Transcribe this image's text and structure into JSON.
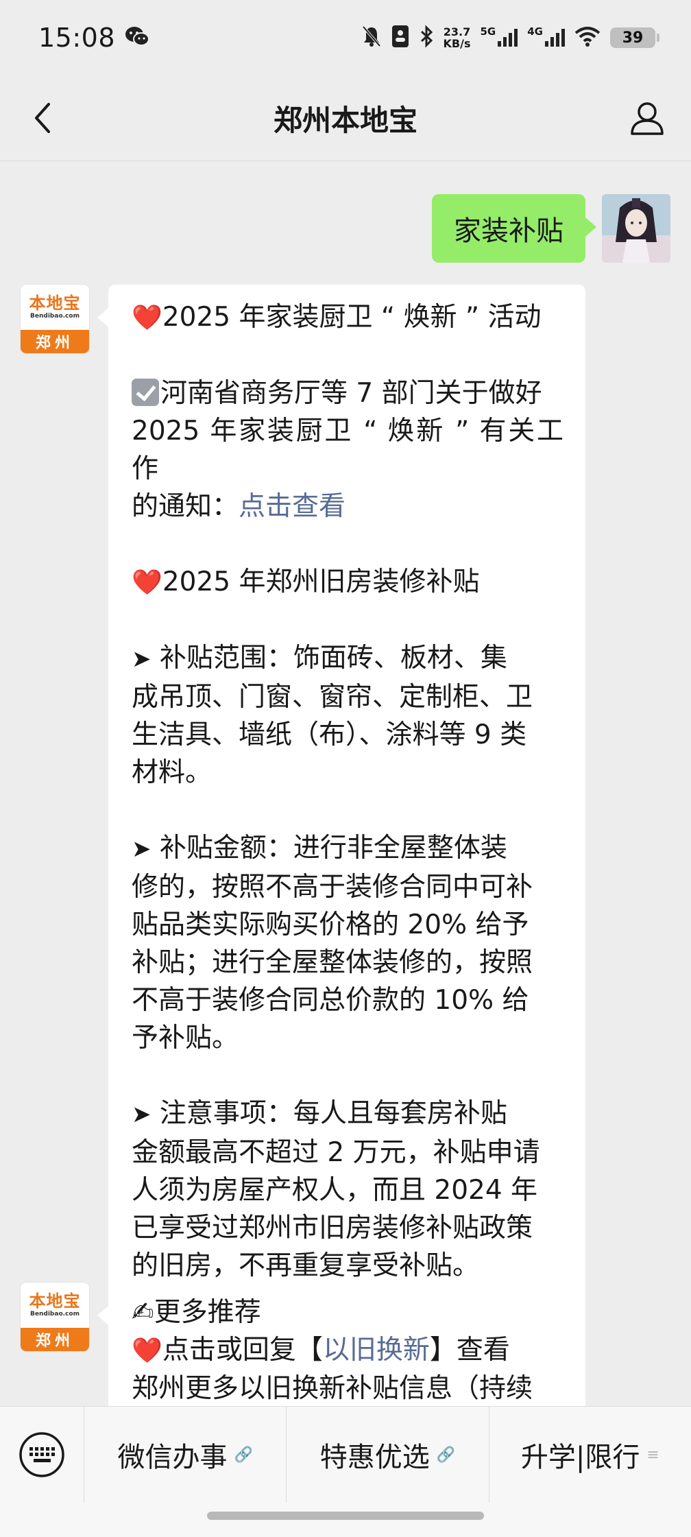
{
  "status_bar": {
    "time": "15:08",
    "net_speed_value": "23.7",
    "net_speed_unit": "KB/s",
    "sim1": "5G",
    "sim2": "4G",
    "battery": "39",
    "icons": [
      "wechat-icon",
      "mute-bell-icon",
      "id-card-icon",
      "bluetooth-icon",
      "signal-icon",
      "signal-icon",
      "wifi-icon",
      "battery-icon"
    ]
  },
  "header": {
    "title": "郑州本地宝",
    "back_icon": "chevron-left-icon",
    "profile_icon": "person-icon"
  },
  "brand_avatar": {
    "name": "本地宝",
    "sub": "Bendibao.com",
    "city": "郑州"
  },
  "sent_message": {
    "text": "家装补贴"
  },
  "message1": {
    "line1": "2025 年家装厨卫 “ 焕新 ” 活动",
    "line2": "河南省商务厅等 7 部门关于做好",
    "line3": "2025 年家装厨卫 “ 焕新 ” 有关工作",
    "line4_prefix": "的通知：",
    "line4_link": "点击查看",
    "line5": "2025 年郑州旧房装修补贴",
    "line6": " 补贴范围：饰面砖、板材、集",
    "line7": "成吊顶、门窗、窗帘、定制柜、卫",
    "line8": "生洁具、墙纸（布）、涂料等 9 类",
    "line9": "材料。",
    "line10": " 补贴金额：进行非全屋整体装",
    "line11": "修的，按照不高于装修合同中可补",
    "line12": "贴品类实际购买价格的 20% 给予",
    "line13": "补贴；进行全屋整体装修的，按照",
    "line14": "不高于装修合同总价款的 10% 给",
    "line15": "予补贴。",
    "line16": " 注意事项：每人且每套房补贴",
    "line17": "金额最高不超过 2 万元，补贴申请",
    "line18": "人须为房屋产权人，而且 2024 年",
    "line19": "已享受过郑州市旧房装修补贴政策",
    "line20": "的旧房，不再重复享受补贴。"
  },
  "message2": {
    "line1": "更多推荐",
    "line2_prefix": "点击或回复【",
    "line2_link": "以旧换新",
    "line2_suffix": "】查看",
    "line3": "郑州更多以旧换新补贴信息（持续"
  },
  "bottom_menu": {
    "items": [
      {
        "label": "微信办事"
      },
      {
        "label": "特惠优选"
      },
      {
        "label": "升学|限行"
      }
    ]
  }
}
